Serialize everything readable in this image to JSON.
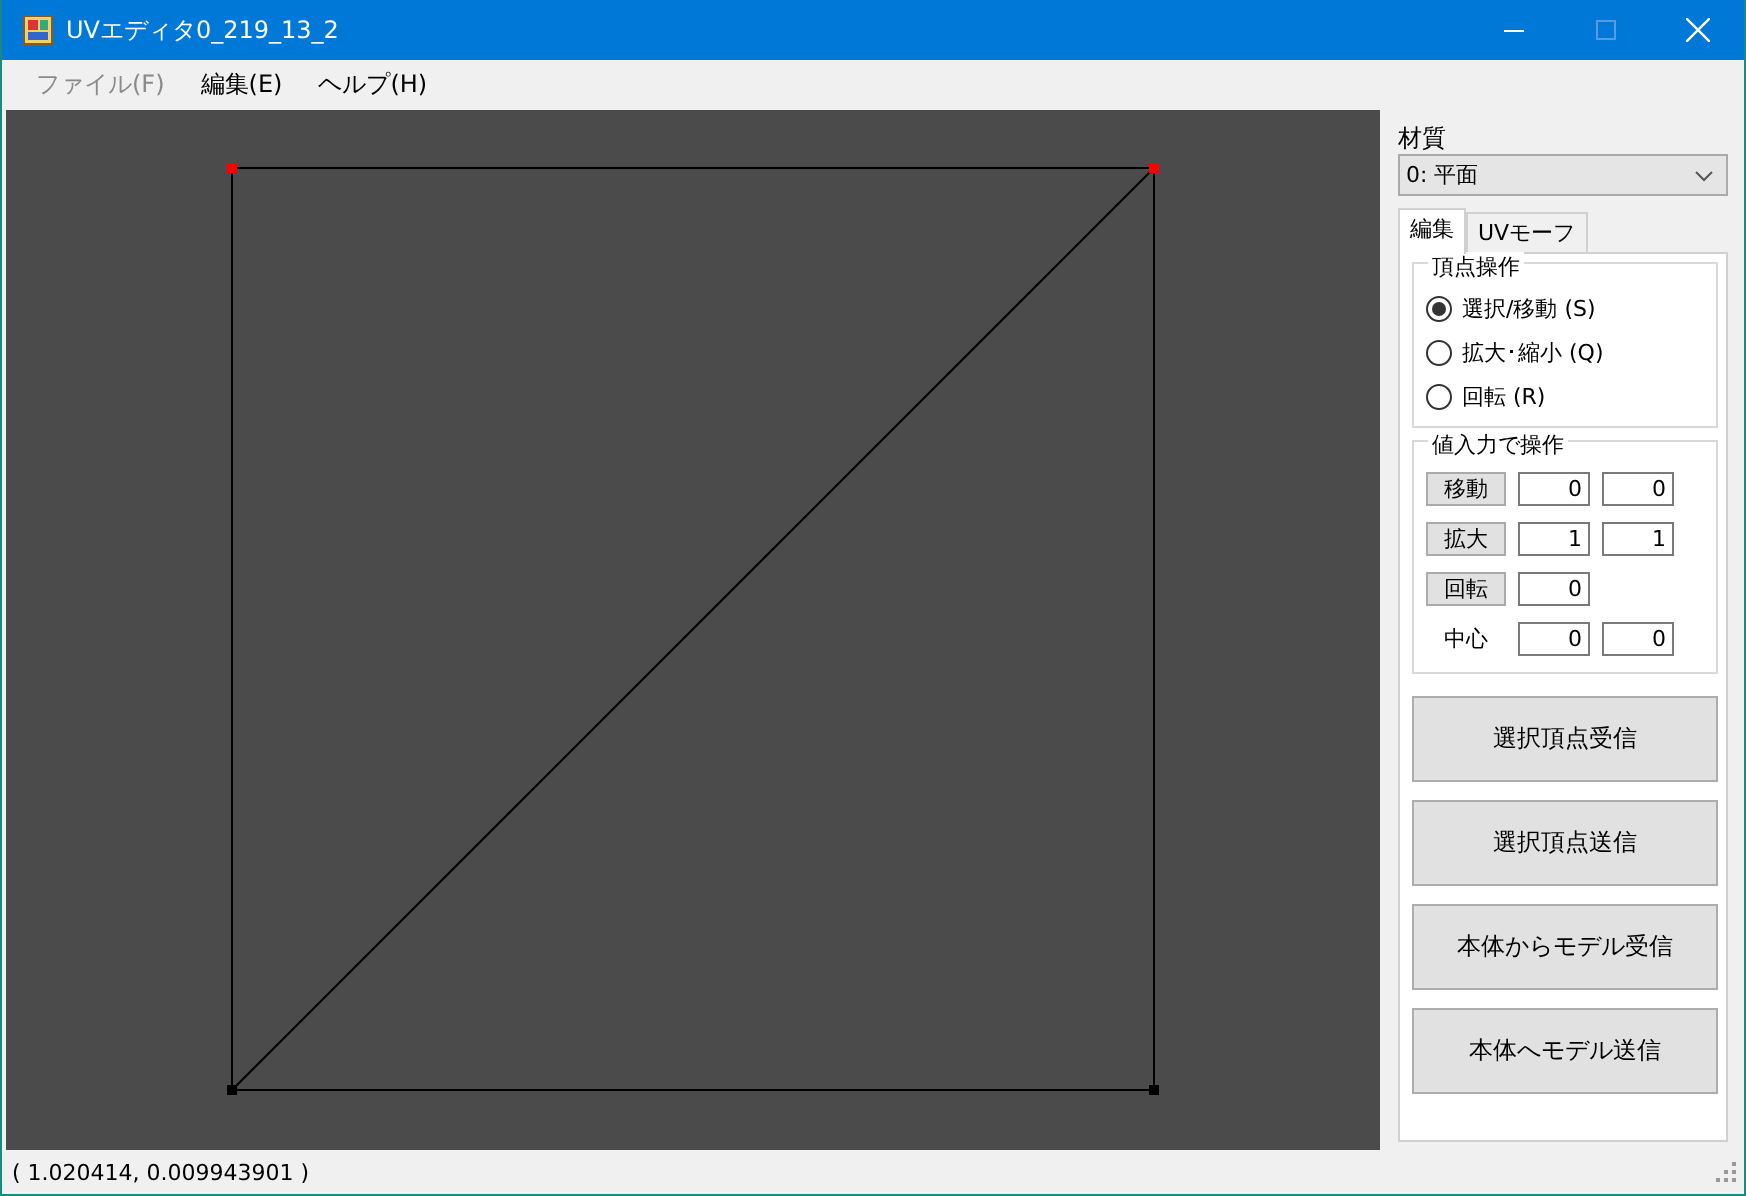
{
  "window": {
    "title": "UVエディタ0_219_13_2"
  },
  "menu": [
    {
      "label": "ファイル(F)",
      "disabled": true
    },
    {
      "label": "編集(E)",
      "disabled": false
    },
    {
      "label": "ヘルプ(H)",
      "disabled": false
    }
  ],
  "canvas": {
    "vertices": [
      {
        "selected": true
      },
      {
        "selected": true
      },
      {
        "selected": false
      },
      {
        "selected": false
      }
    ]
  },
  "material": {
    "label": "材質",
    "value": "0: 平面"
  },
  "tabs": [
    {
      "label": "編集",
      "selected": true
    },
    {
      "label": "UVモーフ",
      "selected": false
    }
  ],
  "vertex_ops": {
    "title": "頂点操作",
    "options": [
      {
        "label": "選択/移動 (S)",
        "selected": true
      },
      {
        "label": "拡大･縮小 (Q)",
        "selected": false
      },
      {
        "label": "回転 (R)",
        "selected": false
      }
    ]
  },
  "value_ops": {
    "title": "値入力で操作",
    "rows": [
      {
        "kind": "button",
        "label": "移動",
        "values": [
          "0",
          "0"
        ]
      },
      {
        "kind": "button",
        "label": "拡大",
        "values": [
          "1",
          "1"
        ]
      },
      {
        "kind": "button",
        "label": "回転",
        "values": [
          "0"
        ]
      },
      {
        "kind": "label",
        "label": "中心",
        "values": [
          "0",
          "0"
        ]
      }
    ]
  },
  "actions": [
    "選択頂点受信",
    "選択頂点送信",
    "本体からモデル受信",
    "本体へモデル送信"
  ],
  "status_bar": {
    "text": "( 1.020414, 0.009943901 )"
  }
}
